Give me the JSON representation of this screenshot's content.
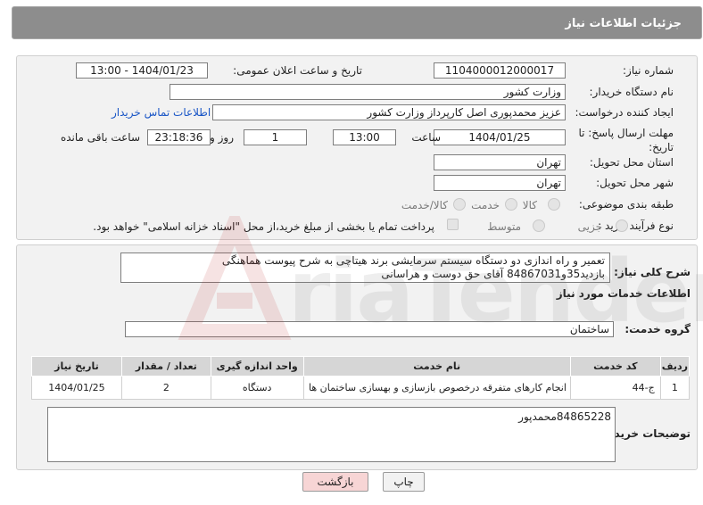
{
  "header": {
    "title": "جزئیات اطلاعات نیاز"
  },
  "fields": {
    "need_number_label": "شماره نیاز:",
    "need_number": "1104000012000017",
    "announce_label": "تاریخ و ساعت اعلان عمومی:",
    "announce_value": "1404/01/23 - 13:00",
    "buyer_org_label": "نام دستگاه خریدار:",
    "buyer_org": "وزارت کشور",
    "creator_label": "ایجاد کننده درخواست:",
    "creator": "عزیز محمدپوری اصل کارپرداز وزارت کشور",
    "contact_link": "اطلاعات تماس خریدار",
    "deadline_label_1": "مهلت ارسال پاسخ: تا",
    "deadline_label_2": "تاریخ:",
    "deadline_date": "1404/01/25",
    "time_label": "ساعت",
    "deadline_time": "13:00",
    "days_value": "1",
    "days_label": "روز و",
    "remaining_time": "23:18:36",
    "remaining_label": "ساعت باقی مانده",
    "province_label": "استان محل تحویل:",
    "province": "تهران",
    "city_label": "شهر محل تحویل:",
    "city": "تهران",
    "category_label": "طبقه بندی موضوعی:",
    "category_options": [
      "کالا",
      "خدمت",
      "کالا/خدمت"
    ],
    "process_label": "نوع فرآیند خرید :",
    "process_options": [
      "جزیی",
      "متوسط"
    ],
    "payment_note": "پرداخت تمام یا بخشی از مبلغ خرید،از محل \"اسناد خزانه اسلامی\" خواهد بود."
  },
  "description": {
    "label": "شرح کلی نیاز:",
    "text": "تعمیر و راه اندازی دو دستگاه سیستم سرمایشی برند هیتاچی به شرح پیوست هماهنگی بازدید35و84867031 آقای حق دوست و هراسانی"
  },
  "services": {
    "section_title": "اطلاعات خدمات مورد نیاز",
    "group_label": "گروه خدمت:",
    "group_value": "ساختمان",
    "columns": [
      "ردیف",
      "کد خدمت",
      "نام خدمت",
      "واحد اندازه گیری",
      "تعداد / مقدار",
      "تاریخ نیاز"
    ],
    "rows": [
      [
        "1",
        "ج-44",
        "انجام کارهای متفرقه درخصوص بازسازی و بهسازی ساختمان ها",
        "دستگاه",
        "2",
        "1404/01/25"
      ]
    ]
  },
  "buyer_notes": {
    "label": "توضیحات خریدار:",
    "text": "84865228محمدپور"
  },
  "buttons": {
    "print": "چاپ",
    "back": "بازگشت"
  },
  "colors": {
    "header_bg": "#8d8d8d",
    "link": "#1a56c6",
    "back_button_bg": "#f7d5d5"
  }
}
